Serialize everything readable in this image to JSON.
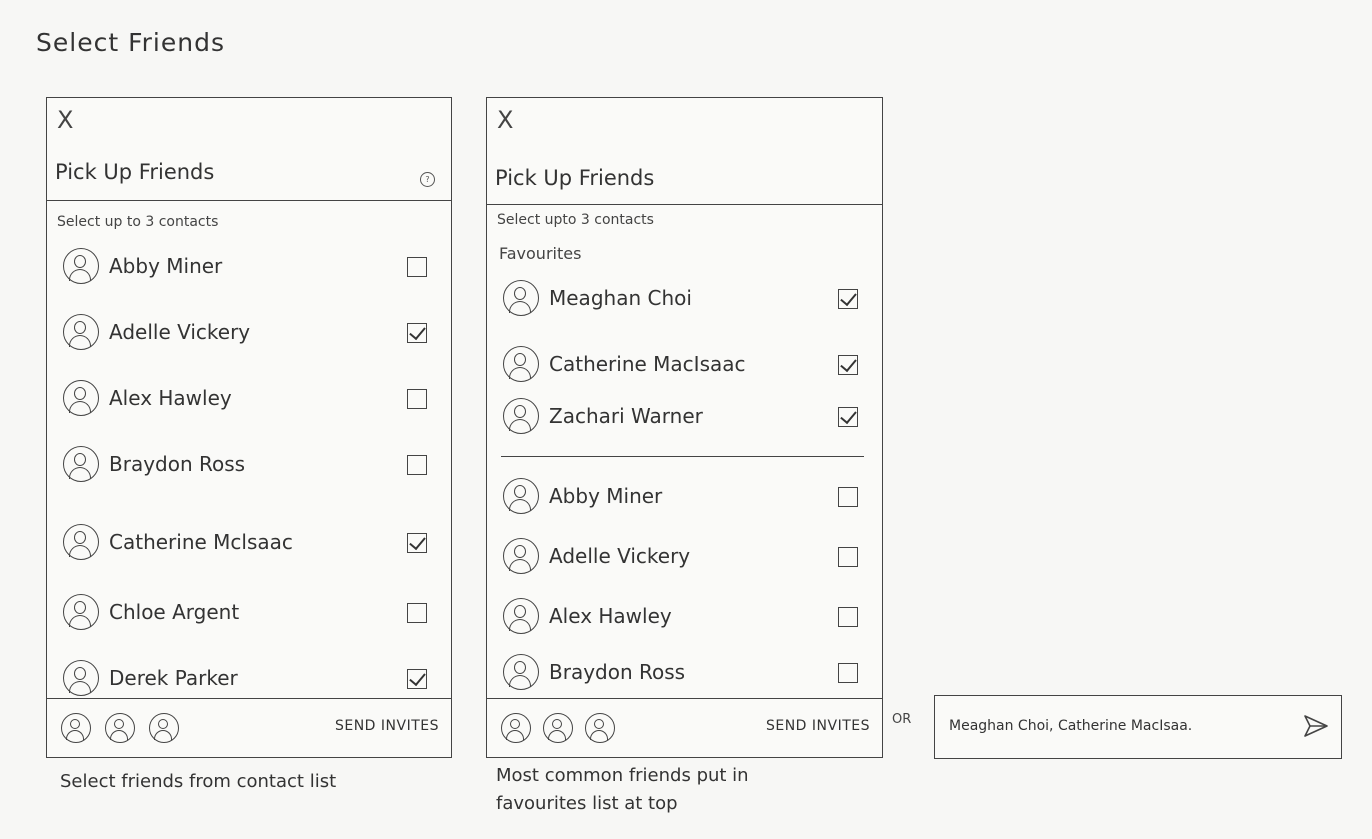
{
  "page_title": "Select Friends",
  "screen_a": {
    "close": "X",
    "title": "Pick Up Friends",
    "help_icon": "?",
    "subtitle": "Select up to 3 contacts",
    "contacts": [
      {
        "name": "Abby Miner",
        "checked": false
      },
      {
        "name": "Adelle Vickery",
        "checked": true
      },
      {
        "name": "Alex Hawley",
        "checked": false
      },
      {
        "name": "Braydon Ross",
        "checked": false
      },
      {
        "name": "Catherine Mclsaac",
        "checked": true
      },
      {
        "name": "Chloe Argent",
        "checked": false
      },
      {
        "name": "Derek Parker",
        "checked": true
      }
    ],
    "send_label": "SEND INVITES",
    "caption": "Select friends from contact list"
  },
  "screen_b": {
    "close": "X",
    "title": "Pick Up Friends",
    "subtitle": "Select upto 3 contacts",
    "favourites_label": "Favourites",
    "favourites": [
      {
        "name": "Meaghan Choi",
        "checked": true
      },
      {
        "name": "Catherine MacIsaac",
        "checked": true
      },
      {
        "name": "Zachari Warner",
        "checked": true
      }
    ],
    "contacts": [
      {
        "name": "Abby Miner",
        "checked": false
      },
      {
        "name": "Adelle Vickery",
        "checked": false
      },
      {
        "name": "Alex Hawley",
        "checked": false
      },
      {
        "name": "Braydon Ross",
        "checked": false
      }
    ],
    "send_label": "SEND INVITES",
    "caption": "Most common friends put in favourites list at top"
  },
  "or_label": "OR",
  "invite_field": {
    "value": "Meaghan Choi, Catherine MacIsaa.",
    "send_icon": "send-arrow-icon"
  }
}
